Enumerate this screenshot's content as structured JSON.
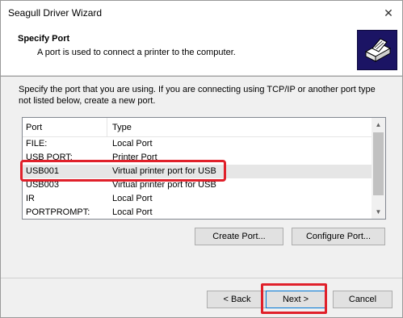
{
  "window": {
    "title": "Seagull Driver Wizard",
    "close_glyph": "✕"
  },
  "header": {
    "title": "Specify Port",
    "subtitle": "A port is used to connect a printer to the computer.",
    "icon": "printer-icon"
  },
  "instructions": "Specify the port that you are using.  If you are connecting using TCP/IP or another port type not listed below, create a new port.",
  "port_list": {
    "columns": [
      "Port",
      "Type"
    ],
    "rows": [
      {
        "port": "FILE:",
        "type": "Local Port"
      },
      {
        "port": "USB PORT:",
        "type": "Printer Port"
      },
      {
        "port": "USB001",
        "type": "Virtual printer port for USB",
        "selected": true
      },
      {
        "port": "USB003",
        "type": "Virtual printer port for USB"
      },
      {
        "port": "IR",
        "type": "Local Port"
      },
      {
        "port": "PORTPROMPT:",
        "type": "Local Port"
      }
    ]
  },
  "buttons": {
    "create_port": "Create Port...",
    "configure_port": "Configure Port...",
    "back": "< Back",
    "next": "Next >",
    "cancel": "Cancel"
  },
  "colors": {
    "highlight": "#e0202a",
    "header_icon_bg": "#1b1464",
    "selected_row": "#e6e6e6"
  }
}
